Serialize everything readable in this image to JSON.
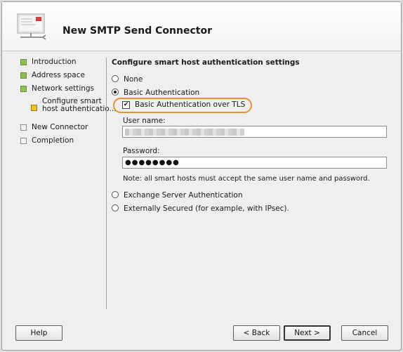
{
  "window": {
    "title": "New SMTP Send Connector"
  },
  "sidebar": {
    "steps": [
      {
        "label": "Introduction",
        "state": "complete"
      },
      {
        "label": "Address space",
        "state": "complete"
      },
      {
        "label": "Network settings",
        "state": "complete"
      },
      {
        "label_line1": "Configure smart",
        "label_line2": "host authenticatio...",
        "state": "current"
      },
      {
        "label": "New Connector",
        "state": "pending"
      },
      {
        "label": "Completion",
        "state": "pending"
      }
    ]
  },
  "content": {
    "heading": "Configure smart host authentication settings",
    "options": {
      "none": "None",
      "basic": "Basic Authentication",
      "basic_tls": "Basic Authentication over TLS",
      "exchange": "Exchange Server Authentication",
      "external": "Externally Secured (for example, with IPsec)."
    },
    "selected_option": "basic",
    "basic_tls_checked": true,
    "username_label": "User name:",
    "password_label": "Password:",
    "password_value": "●●●●●●●●",
    "note": "Note: all smart hosts must accept the same user name and password."
  },
  "buttons": {
    "help": "Help",
    "back": "< Back",
    "next": "Next >",
    "cancel": "Cancel"
  },
  "colors": {
    "complete_step": "#8cc152",
    "current_step": "#f0c419",
    "highlight_ring": "#e8922a"
  }
}
